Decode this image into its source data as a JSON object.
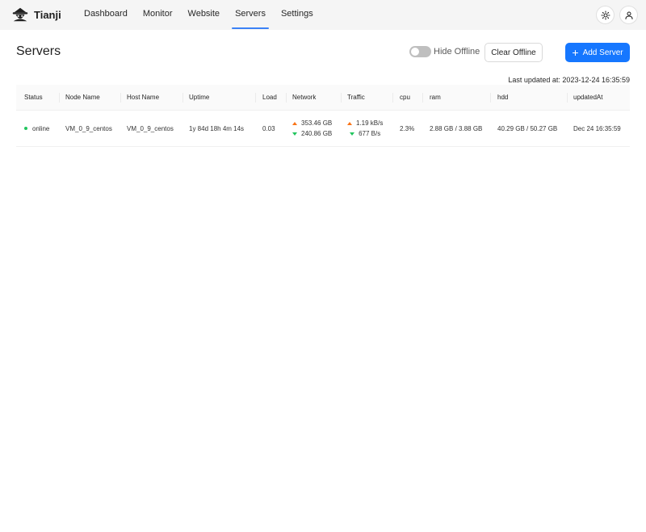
{
  "brand": {
    "name": "Tianji",
    "logo": "tianji-logo-icon"
  },
  "nav": [
    {
      "label": "Dashboard",
      "active": false
    },
    {
      "label": "Monitor",
      "active": false
    },
    {
      "label": "Website",
      "active": false
    },
    {
      "label": "Servers",
      "active": true
    },
    {
      "label": "Settings",
      "active": false
    }
  ],
  "header_icons": {
    "theme": "sun-icon",
    "user": "user-icon"
  },
  "page": {
    "title": "Servers",
    "hide_offline_label": "Hide Offline",
    "hide_offline_enabled": false,
    "clear_offline_label": "Clear Offline",
    "add_server_label": "Add Server",
    "last_updated": "Last updated at: 2023-12-24 16:35:59"
  },
  "table": {
    "columns": [
      "Status",
      "Node Name",
      "Host Name",
      "Uptime",
      "Load",
      "Network",
      "Traffic",
      "cpu",
      "ram",
      "hdd",
      "updatedAt"
    ],
    "rows": [
      {
        "status": "online",
        "node_name": "VM_0_9_centos",
        "host_name": "VM_0_9_centos",
        "uptime": "1y 84d 18h 4m 14s",
        "load": "0.03",
        "network_up": "353.46 GB",
        "network_down": "240.86 GB",
        "traffic_up": "1.19 kB/s",
        "traffic_down": "677 B/s",
        "cpu": "2.3%",
        "ram": "2.88 GB / 3.88 GB",
        "hdd": "40.29 GB / 50.27 GB",
        "updated_at": "Dec 24 16:35:59"
      }
    ]
  },
  "colors": {
    "primary": "#1677ff",
    "online": "#22c55e",
    "up_arrow": "#f97316",
    "down_arrow": "#22c55e",
    "nav_active": "#3b82f6"
  }
}
